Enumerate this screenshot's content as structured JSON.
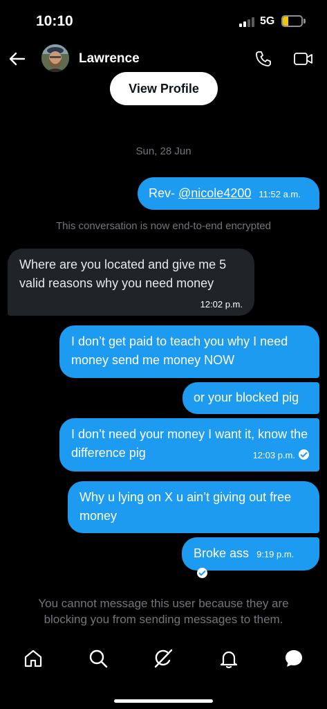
{
  "status_bar": {
    "time": "10:10",
    "network": "5G",
    "battery": "9",
    "battery_level": 0.09
  },
  "header": {
    "contact_name": "Lawrence"
  },
  "profile": {
    "view_profile_label": "View Profile"
  },
  "conversation": {
    "date": "Sun, 28 Jun",
    "encryption_note": "This conversation is now end-to-end encrypted",
    "blocked_note": "You cannot message this user because they are blocking you from sending messages to them."
  },
  "messages": [
    {
      "direction": "out",
      "prefix": "Rev- ",
      "mention": "@nicole4200",
      "time": "11:52 a.m."
    },
    {
      "direction": "in",
      "text": "Where are you located and give me 5 valid reasons why you need money",
      "time": "12:02 p.m."
    },
    {
      "direction": "out",
      "text": "I don’t get paid to teach you why I need money send me money NOW"
    },
    {
      "direction": "out",
      "text": "or your blocked pig"
    },
    {
      "direction": "out",
      "text": "I don’t need your money I want it, know the difference pig",
      "time": "12:03 p.m.",
      "read": true
    },
    {
      "direction": "out",
      "text": "Why u lying on X u ain’t giving out free money"
    },
    {
      "direction": "out",
      "text": "Broke ass",
      "time": "9:19 p.m.",
      "read": true
    }
  ],
  "icons": {
    "back": "arrow-left-icon",
    "call": "phone-icon",
    "video": "video-camera-icon",
    "tabs": [
      "home-icon",
      "search-icon",
      "grok-icon",
      "bell-icon",
      "messages-icon"
    ]
  },
  "colors": {
    "accent": "#1d9bf0",
    "incoming": "#202327",
    "muted": "#71767b",
    "battery": "#f2c500"
  }
}
